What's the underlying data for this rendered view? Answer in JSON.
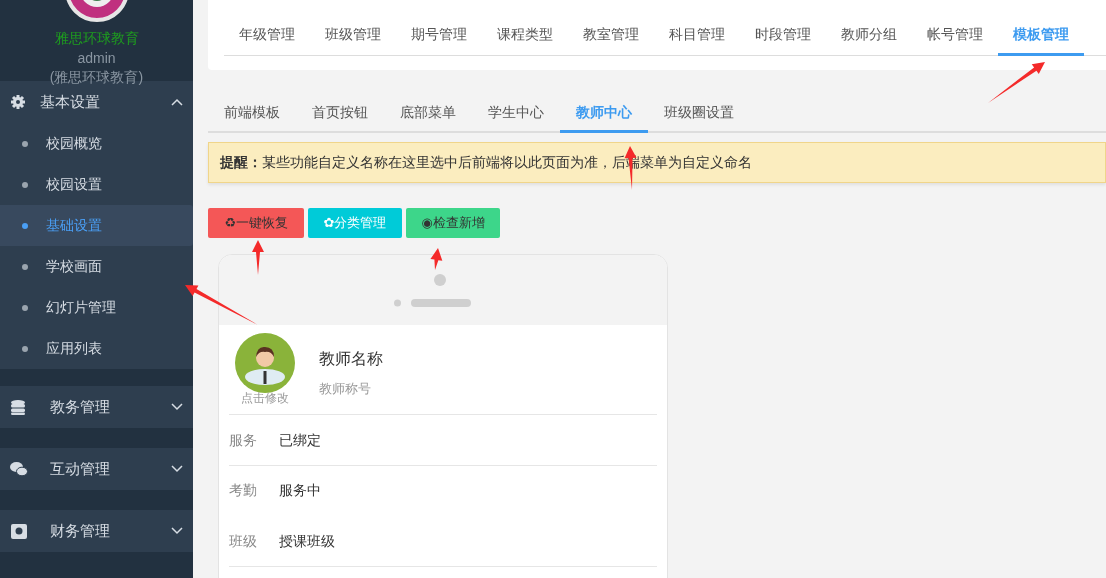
{
  "sidebar": {
    "school_name": "雅思环球教育",
    "user": "admin",
    "org": "(雅思环球教育)",
    "groups": [
      {
        "label": "基本设置",
        "kind": "gear",
        "expanded": true,
        "children": [
          {
            "label": "校园概览",
            "selected": false
          },
          {
            "label": "校园设置",
            "selected": false
          },
          {
            "label": "基础设置",
            "selected": true
          },
          {
            "label": "学校画面",
            "selected": false
          },
          {
            "label": "幻灯片管理",
            "selected": false
          },
          {
            "label": "应用列表",
            "selected": false
          }
        ]
      },
      {
        "label": "教务管理",
        "kind": "database",
        "expanded": false
      },
      {
        "label": "互动管理",
        "kind": "chat",
        "expanded": false
      },
      {
        "label": "财务管理",
        "kind": "money",
        "expanded": false
      }
    ]
  },
  "top_tabs": [
    {
      "label": "年级管理",
      "selected": false
    },
    {
      "label": "班级管理",
      "selected": false
    },
    {
      "label": "期号管理",
      "selected": false
    },
    {
      "label": "课程类型",
      "selected": false
    },
    {
      "label": "教室管理",
      "selected": false
    },
    {
      "label": "科目管理",
      "selected": false
    },
    {
      "label": "时段管理",
      "selected": false
    },
    {
      "label": "教师分组",
      "selected": false
    },
    {
      "label": "帐号管理",
      "selected": false
    },
    {
      "label": "模板管理",
      "selected": true
    }
  ],
  "sub_tabs": [
    {
      "label": "前端模板",
      "selected": false
    },
    {
      "label": "首页按钮",
      "selected": false
    },
    {
      "label": "底部菜单",
      "selected": false
    },
    {
      "label": "学生中心",
      "selected": false
    },
    {
      "label": "教师中心",
      "selected": true
    },
    {
      "label": "班级圈设置",
      "selected": false
    }
  ],
  "alert": {
    "text": "**提醒：**某些功能自定义名称在这里选中后前端将以此页面为准，后端菜单为自定义命名"
  },
  "buttons": [
    {
      "label": "♻一键恢复",
      "kind": "restore"
    },
    {
      "label": "✿分类管理",
      "kind": "category"
    },
    {
      "label": "◉检查新增",
      "kind": "check"
    }
  ],
  "phone": {
    "teacher_name": "教师名称",
    "teacher_title": "教师称号",
    "avatar_caption": "点击修改",
    "rows": [
      {
        "label": "服务",
        "value": "已绑定"
      },
      {
        "label": "考勤",
        "value": "服务中"
      },
      {
        "label": "班级",
        "value": "授课班级"
      }
    ]
  }
}
